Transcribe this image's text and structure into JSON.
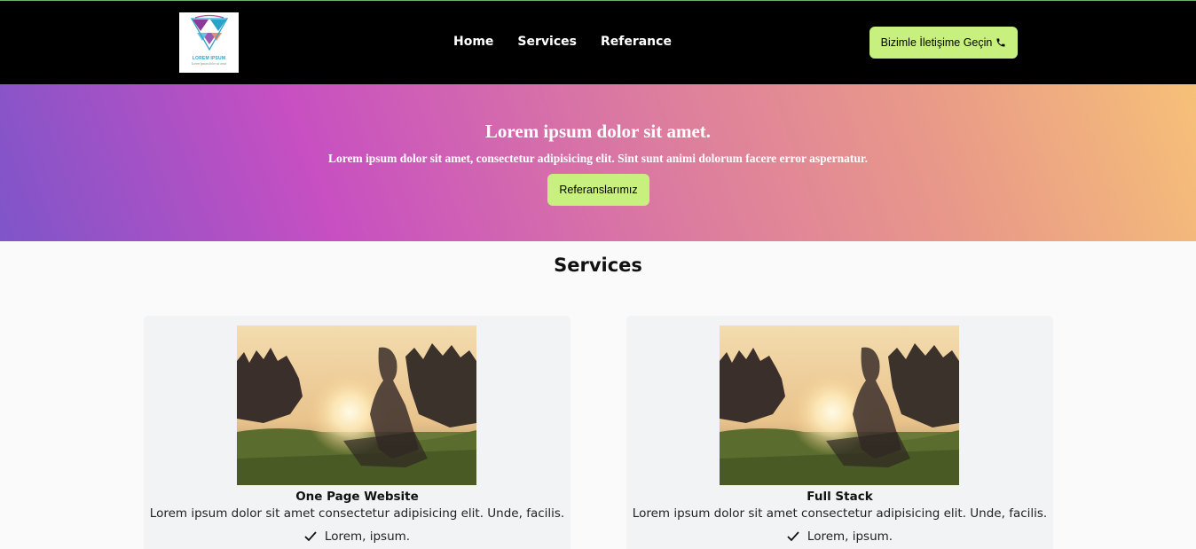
{
  "header": {
    "logo": {
      "name": "LOREM IPSUM",
      "slogan": "Lorem ipsum dolor sit amet"
    },
    "nav": [
      {
        "label": "Home"
      },
      {
        "label": "Services"
      },
      {
        "label": "Referance"
      }
    ],
    "contact_button": {
      "label": "Bizimle İletişime Geçin",
      "icon": "phone-icon"
    }
  },
  "hero": {
    "title": "Lorem ipsum dolor sit amet.",
    "subtitle": "Lorem ipsum dolor sit amet, consectetur adipisicing elit. Sint sunt animi dolorum facere error aspernatur.",
    "button_label": "Referanslarımız"
  },
  "services": {
    "title": "Services",
    "cards": [
      {
        "title": "One Page Website",
        "description": "Lorem ipsum dolor sit amet consectetur adipisicing elit. Unde, facilis.",
        "features": [
          "Lorem, ipsum."
        ]
      },
      {
        "title": "Full Stack",
        "description": "Lorem ipsum dolor sit amet consectetur adipisicing elit. Unde, facilis.",
        "features": [
          "Lorem, ipsum."
        ]
      }
    ]
  },
  "colors": {
    "navbar": "#000000",
    "accent_button": "#c8f07e",
    "hero_gradient": [
      "#7e55c9",
      "#c74fc2",
      "#dc7ba0",
      "#e99a88",
      "#f6c078"
    ],
    "card_background": "#f2f3f5"
  }
}
